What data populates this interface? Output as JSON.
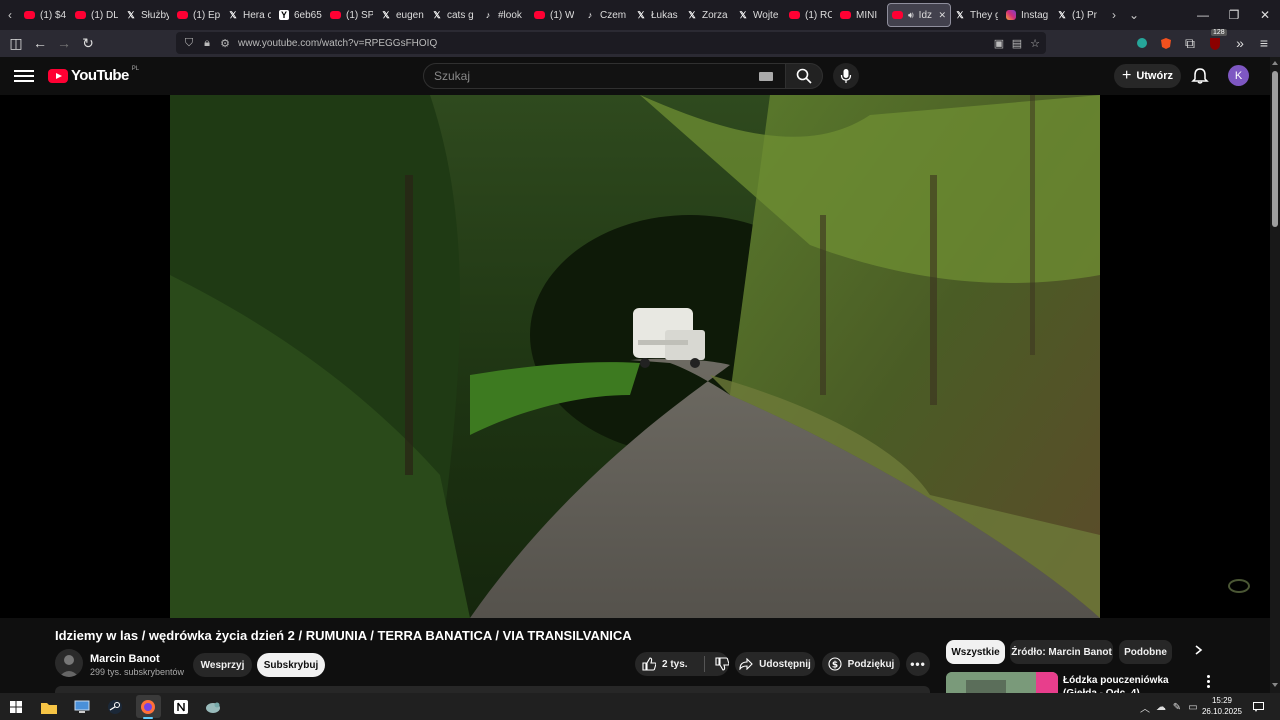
{
  "browser": {
    "tabs": [
      {
        "label": "(1) $4",
        "icon": "yt"
      },
      {
        "label": "(1) DL",
        "icon": "yt"
      },
      {
        "label": "Służby",
        "icon": "x"
      },
      {
        "label": "(1) Ep",
        "icon": "yt"
      },
      {
        "label": "Hera c",
        "icon": "x"
      },
      {
        "label": "6eb65",
        "icon": "y"
      },
      {
        "label": "(1) SP",
        "icon": "yt"
      },
      {
        "label": "eugen",
        "icon": "x"
      },
      {
        "label": "cats g",
        "icon": "x"
      },
      {
        "label": "#look",
        "icon": "tt"
      },
      {
        "label": "(1) W",
        "icon": "yt"
      },
      {
        "label": "Czem",
        "icon": "tt"
      },
      {
        "label": "Łukas",
        "icon": "x"
      },
      {
        "label": "Zorza",
        "icon": "x"
      },
      {
        "label": "Wojte",
        "icon": "x"
      },
      {
        "label": "(1) RC",
        "icon": "yt"
      },
      {
        "label": "MINI",
        "icon": "yt"
      },
      {
        "label": "Idz",
        "icon": "yt",
        "active": true
      },
      {
        "label": "They g",
        "icon": "x"
      },
      {
        "label": "Instag",
        "icon": "ig"
      },
      {
        "label": "(1) Pr",
        "icon": "x"
      }
    ],
    "url": "www.youtube.com/watch?v=RPEGGsFHOIQ",
    "extension_badge": "128"
  },
  "youtube": {
    "logo_text": "YouTube",
    "country_code": "PL",
    "search_placeholder": "Szukaj",
    "create_label": "Utwórz",
    "avatar_letter": "K"
  },
  "video": {
    "title": "Idziemy w las / wędrówka życia dzień 2 / RUMUNIA / TERRA BANATICA / VIA TRANSILVANICA",
    "channel_name": "Marcin Banot",
    "subscribers": "299 tys. subskrybentów",
    "support_label": "Wesprzyj",
    "subscribe_label": "Subskrybuj",
    "likes": "2 tys.",
    "share_label": "Udostępnij",
    "thanks_label": "Podziękuj"
  },
  "sidebar": {
    "chips": [
      "Wszystkie",
      "Źródło: Marcin Banot",
      "Podobne"
    ],
    "recommended": [
      {
        "title": "Łódzka pouczeniówka (Giełda - Odc. 4)"
      }
    ]
  },
  "taskbar": {
    "time": "15:29",
    "date": "26.10.2025"
  },
  "colors": {
    "yt_red": "#ff0033",
    "page_bg": "#0f0f0f",
    "avatar_purple": "#7e57c2"
  }
}
